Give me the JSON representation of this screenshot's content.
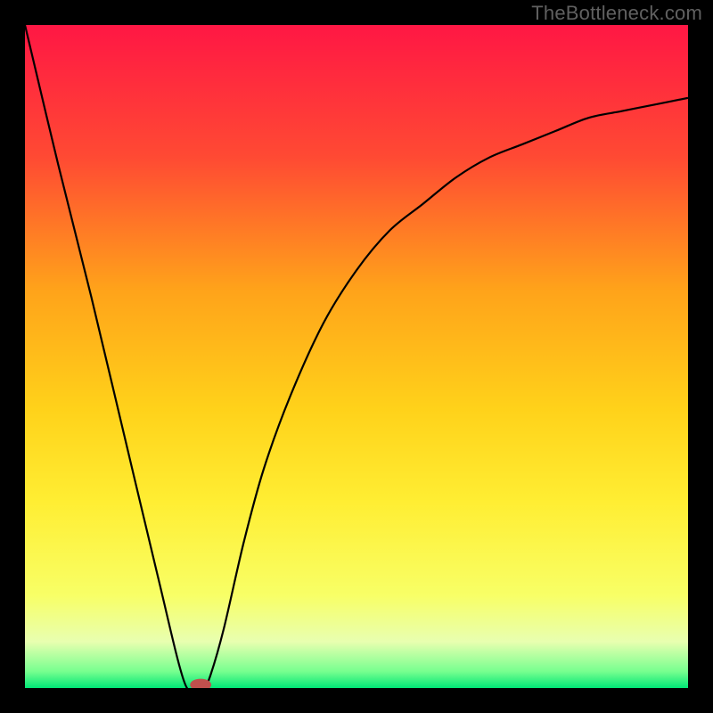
{
  "watermark": "TheBottleneck.com",
  "chart_data": {
    "type": "line",
    "title": "",
    "xlabel": "",
    "ylabel": "",
    "xlim": [
      0,
      100
    ],
    "ylim": [
      0,
      100
    ],
    "axes_visible": false,
    "grid": false,
    "background": {
      "kind": "vertical-gradient",
      "stops": [
        {
          "pos": 0.0,
          "color": "#ff1744"
        },
        {
          "pos": 0.2,
          "color": "#ff4a33"
        },
        {
          "pos": 0.4,
          "color": "#ffa31a"
        },
        {
          "pos": 0.58,
          "color": "#ffd21a"
        },
        {
          "pos": 0.72,
          "color": "#ffee33"
        },
        {
          "pos": 0.86,
          "color": "#f8ff66"
        },
        {
          "pos": 0.93,
          "color": "#e8ffb0"
        },
        {
          "pos": 0.975,
          "color": "#77ff8f"
        },
        {
          "pos": 1.0,
          "color": "#00e676"
        }
      ]
    },
    "series": [
      {
        "name": "bottleneck-curve",
        "kind": "curve",
        "x": [
          0,
          5,
          10,
          15,
          20,
          24,
          26,
          27,
          28,
          30,
          33,
          36,
          40,
          45,
          50,
          55,
          60,
          65,
          70,
          75,
          80,
          85,
          90,
          95,
          100
        ],
        "y": [
          100,
          79,
          59,
          38,
          17,
          1,
          0,
          0,
          2,
          9,
          22,
          33,
          44,
          55,
          63,
          69,
          73,
          77,
          80,
          82,
          84,
          86,
          87,
          88,
          89
        ]
      }
    ],
    "minimum_marker": {
      "x": 26.5,
      "y": 0.5,
      "color": "#c0504d",
      "rx": 1.6,
      "ry": 0.9
    }
  }
}
